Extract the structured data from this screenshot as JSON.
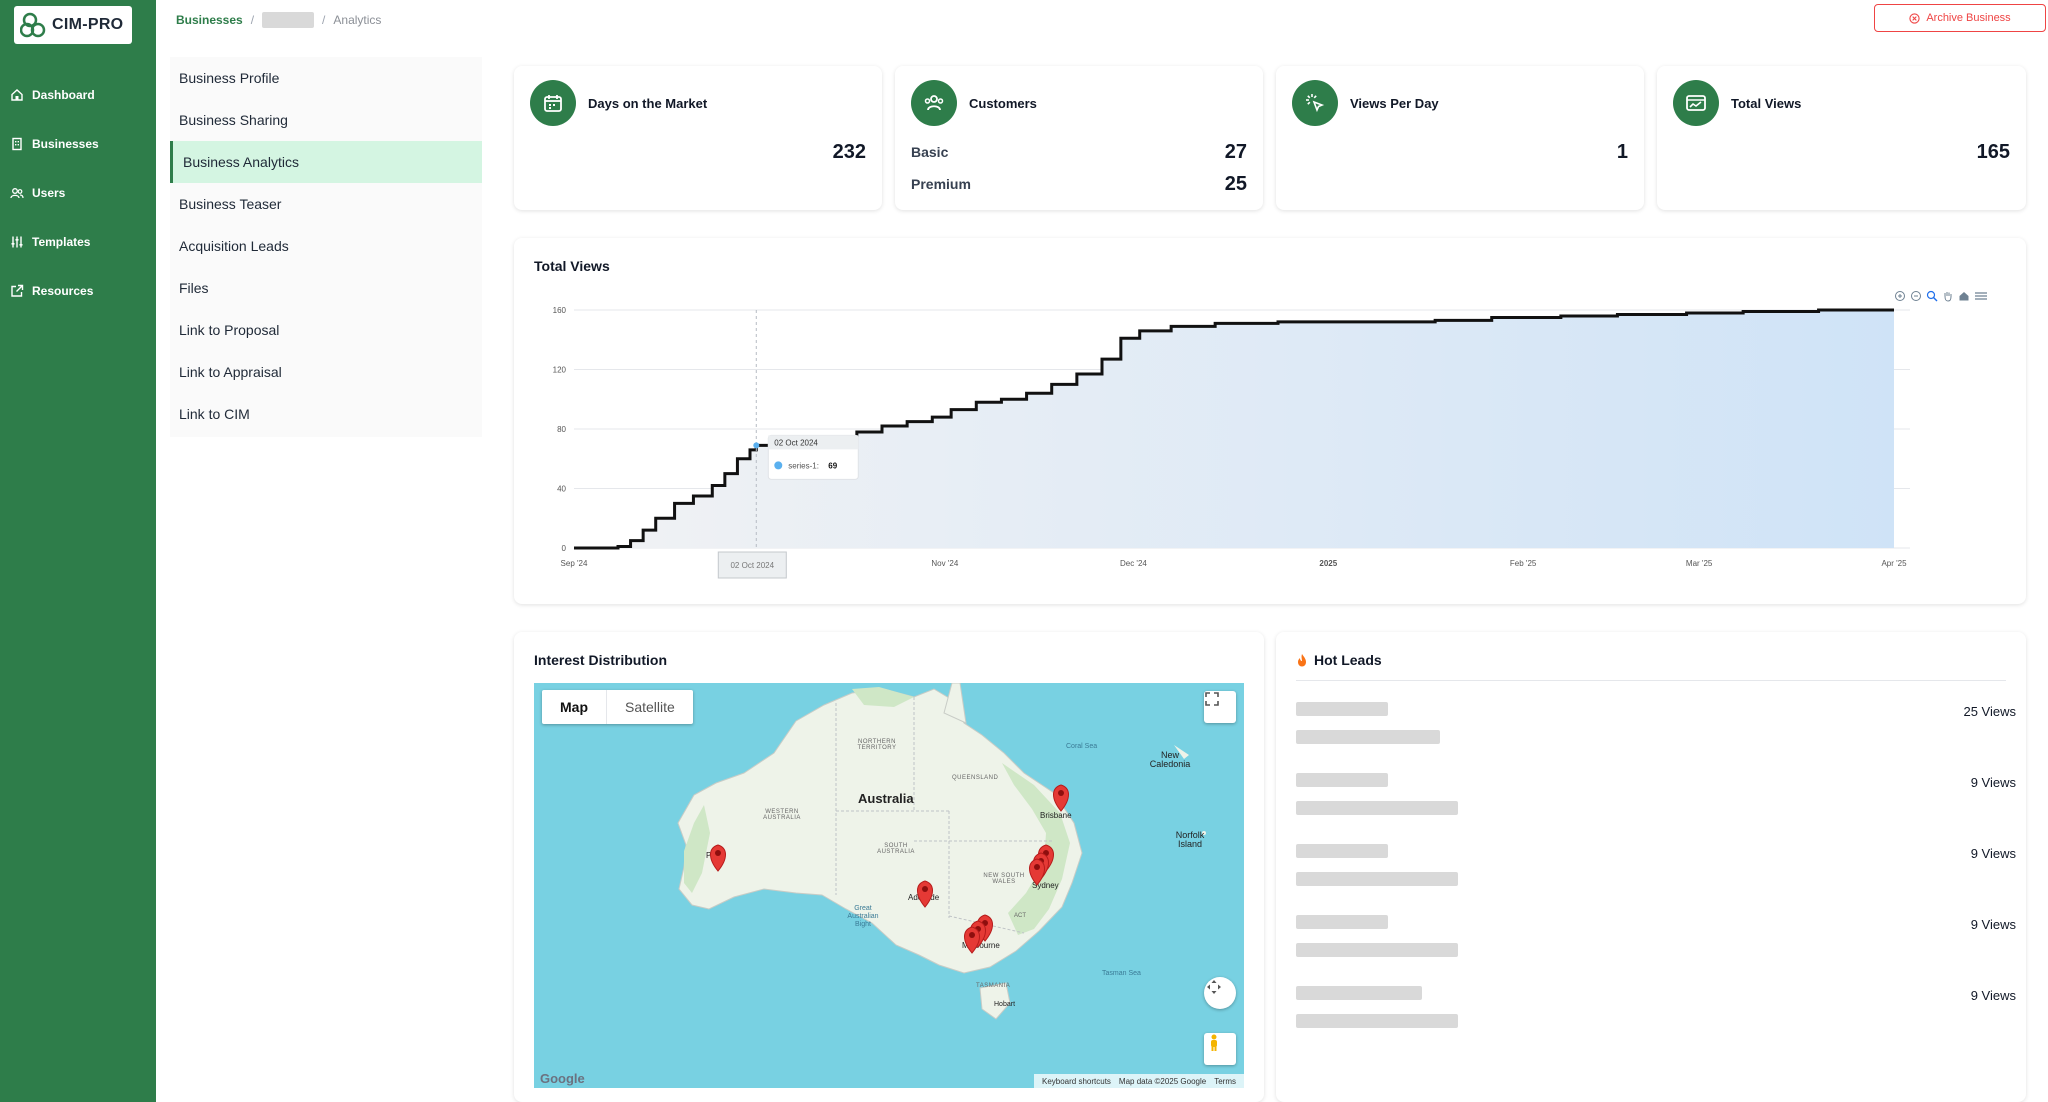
{
  "app": {
    "name": "CIM-PRO"
  },
  "sidebar": {
    "items": [
      {
        "label": "Dashboard",
        "icon": "home-icon"
      },
      {
        "label": "Businesses",
        "icon": "building-icon"
      },
      {
        "label": "Users",
        "icon": "users-icon"
      },
      {
        "label": "Templates",
        "icon": "sliders-icon"
      },
      {
        "label": "Resources",
        "icon": "external-link-icon"
      }
    ]
  },
  "breadcrumb": {
    "root": "Businesses",
    "current": "Analytics"
  },
  "header": {
    "archive_label": "Archive Business"
  },
  "submenu": {
    "items": [
      {
        "label": "Business Profile"
      },
      {
        "label": "Business Sharing"
      },
      {
        "label": "Business Analytics",
        "active": true
      },
      {
        "label": "Business Teaser"
      },
      {
        "label": "Acquisition Leads"
      },
      {
        "label": "Files"
      },
      {
        "label": "Link to Proposal"
      },
      {
        "label": "Link to Appraisal"
      },
      {
        "label": "Link to CIM"
      }
    ]
  },
  "stats": {
    "days": {
      "title": "Days on the Market",
      "value": "232"
    },
    "customers": {
      "title": "Customers",
      "basic_label": "Basic",
      "basic_value": "27",
      "premium_label": "Premium",
      "premium_value": "25"
    },
    "views_per_day": {
      "title": "Views Per Day",
      "value": "1"
    },
    "total_views": {
      "title": "Total Views",
      "value": "165"
    }
  },
  "total_views_section": {
    "title": "Total Views"
  },
  "chart_data": {
    "type": "area",
    "title": "Total Views",
    "x_ticks": [
      "Sep '24",
      "Nov '24",
      "Dec '24",
      "2025",
      "Feb '25",
      "Mar '25",
      "Apr '25"
    ],
    "y_ticks": [
      "0",
      "40",
      "80",
      "120",
      "160"
    ],
    "ylim": [
      0,
      160
    ],
    "xlim": [
      "2024-09-03",
      "2025-04-01"
    ],
    "series": [
      {
        "name": "series-1",
        "points": [
          [
            "2024-09-03",
            0
          ],
          [
            "2024-09-10",
            1
          ],
          [
            "2024-09-12",
            5
          ],
          [
            "2024-09-14",
            12
          ],
          [
            "2024-09-16",
            20
          ],
          [
            "2024-09-19",
            30
          ],
          [
            "2024-09-22",
            35
          ],
          [
            "2024-09-25",
            42
          ],
          [
            "2024-09-27",
            50
          ],
          [
            "2024-09-29",
            60
          ],
          [
            "2024-10-01",
            66
          ],
          [
            "2024-10-02",
            69
          ],
          [
            "2024-10-06",
            70
          ],
          [
            "2024-10-09",
            71
          ],
          [
            "2024-10-14",
            73
          ],
          [
            "2024-10-18",
            78
          ],
          [
            "2024-10-22",
            82
          ],
          [
            "2024-10-26",
            85
          ],
          [
            "2024-10-30",
            88
          ],
          [
            "2024-11-02",
            93
          ],
          [
            "2024-11-06",
            98
          ],
          [
            "2024-11-10",
            100
          ],
          [
            "2024-11-14",
            104
          ],
          [
            "2024-11-18",
            110
          ],
          [
            "2024-11-22",
            117
          ],
          [
            "2024-11-26",
            127
          ],
          [
            "2024-11-29",
            141
          ],
          [
            "2024-12-02",
            146
          ],
          [
            "2024-12-07",
            149
          ],
          [
            "2024-12-14",
            151
          ],
          [
            "2024-12-24",
            152
          ],
          [
            "2025-01-08",
            152
          ],
          [
            "2025-01-18",
            153
          ],
          [
            "2025-01-27",
            155
          ],
          [
            "2025-02-07",
            156
          ],
          [
            "2025-02-16",
            157
          ],
          [
            "2025-02-27",
            158
          ],
          [
            "2025-03-08",
            159
          ],
          [
            "2025-03-20",
            160
          ],
          [
            "2025-04-01",
            160
          ]
        ]
      }
    ],
    "tooltip": {
      "date": "02 Oct 2024",
      "series": "series-1:",
      "value": "69"
    },
    "crosshair_label": "02 Oct 2024",
    "grid": true,
    "legend": "none",
    "line_color": "#111111",
    "fill_color": "#cfe3f7"
  },
  "interest_distribution": {
    "title": "Interest Distribution",
    "map_label": "Map",
    "satellite_label": "Satellite",
    "labels": {
      "country": "Australia",
      "nt": "NORTHERN TERRITORY",
      "qld": "QUEENSLAND",
      "wa": "WESTERN AUSTRALIA",
      "sa": "SOUTH AUSTRALIA",
      "nsw": "NEW SOUTH WALES",
      "act": "ACT",
      "tas": "TASMANIA",
      "coral_sea": "Coral Sea",
      "tasman_sea": "Tasman Sea",
      "bight": "Great Australian Bight",
      "new_caledonia": "New Caledonia",
      "norfolk": "Norfolk Island",
      "brisbane": "Brisbane",
      "sydney": "Sydney",
      "melbourne": "Melbourne",
      "adelaide": "Adelaide",
      "perth": "Perth",
      "hobart": "Hobart"
    },
    "footer": {
      "keyboard": "Keyboard shortcuts",
      "data": "Map data ©2025 Google",
      "terms": "Terms"
    },
    "google": "Google"
  },
  "hot_leads": {
    "title": "Hot Leads",
    "items": [
      {
        "views": "25 Views"
      },
      {
        "views": "9 Views"
      },
      {
        "views": "9 Views"
      },
      {
        "views": "9 Views"
      },
      {
        "views": "9 Views"
      }
    ]
  },
  "colors": {
    "brand": "#2e7d4a",
    "danger": "#ef4444",
    "active_bg": "#d4f5e2"
  }
}
